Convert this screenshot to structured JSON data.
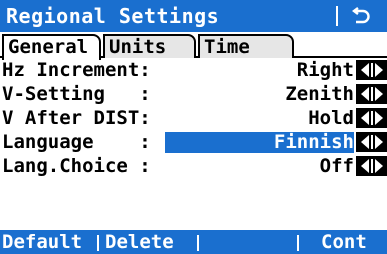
{
  "title": "Regional Settings",
  "tabs": [
    "General",
    "Units",
    "Time"
  ],
  "rows": [
    {
      "label": "Hz Increment:",
      "value": "Right"
    },
    {
      "label": "V-Setting   :",
      "value": "Zenith"
    },
    {
      "label": "V After DIST:",
      "value": "Hold"
    },
    {
      "label": "Language    :",
      "value": "Finnish"
    },
    {
      "label": "Lang.Choice :",
      "value": "Off"
    }
  ],
  "softkeys": [
    "Default",
    "Delete",
    "",
    "",
    "Cont"
  ],
  "icons": {
    "back": "back-arrow-icon",
    "selector": "left-right-arrows-icon"
  },
  "colors": {
    "accent": "#1a6fcf"
  }
}
